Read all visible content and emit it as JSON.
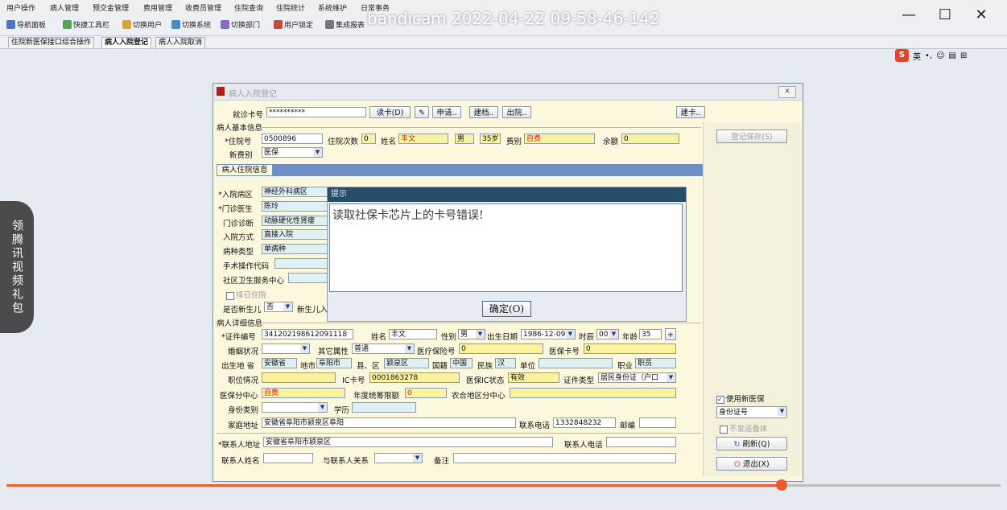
{
  "recorder": {
    "title": "bandicam 2022-04-22 09-58-46-142",
    "side_text": "领腾讯视频礼包",
    "progress_fraction": 0.78
  },
  "window_controls": {
    "minimize": "—",
    "maximize": "☐",
    "close": "✕"
  },
  "menubar": [
    "用户操作",
    "病人管理",
    "预交金管理",
    "费用管理",
    "收费员管理",
    "住院查询",
    "住院统计",
    "系统维护",
    "日常事务"
  ],
  "toolbar": [
    "导航面板",
    "快捷工具栏",
    "切换用户",
    "切换系统",
    "切换部门",
    "用户锁定",
    "集成报表"
  ],
  "app_tabs": [
    "住院新医保接口综合操作",
    "病人入院登记",
    "病人入院取消"
  ],
  "ime": {
    "logo": "S",
    "mode": "英"
  },
  "dialog": {
    "title": "病人入院登记",
    "card": {
      "label": "就诊卡号",
      "value": "**********"
    },
    "top_buttons": {
      "read_card": "读卡(D)",
      "apply": "申请..",
      "edit": "建档..",
      "discharge": "出院..",
      "make_card": "建卡.."
    },
    "basic_section": "病人基本信息",
    "basic": {
      "inpatient_no_label": "*住院号",
      "inpatient_no": "0500896",
      "times_label": "住院次数",
      "times": "0",
      "name_label": "姓名",
      "name": "丰文",
      "gender": "男",
      "age": "35岁",
      "fee_type_label": "费别",
      "fee_type": "自费",
      "balance_label": "余额",
      "balance": "0",
      "new_fee_type_label": "新费别",
      "new_fee_type": "医保"
    },
    "inner_tab": "病人住院信息",
    "admission": {
      "ward_label": "*入院病区",
      "ward": "神经外科病区",
      "doctor_label": "*门诊医生",
      "doctor": "陈玲",
      "diagnosis_label": "门诊诊断",
      "diagnosis": "动脉硬化性肾瘘",
      "way_label": "入院方式",
      "way": "直接入院",
      "disease_type_label": "病种类型",
      "disease_type": "单病种",
      "surgery_label": "手术操作代码",
      "surgery": "",
      "community_label": "社区卫生服务中心",
      "community": "",
      "same_day": "择日住院",
      "newborn_label": "是否新生儿",
      "newborn": "否",
      "newborn_in_label": "新生儿入"
    },
    "detail_section": "病人详细信息",
    "detail": {
      "id_label": "*证件编号",
      "id_no": "341202198612091118",
      "name_label": "姓名",
      "name": "丰文",
      "gender_label": "性别",
      "gender": "男",
      "birth_label": "出生日期",
      "birth": "1986-12-09",
      "hour_label": "时辰",
      "hour": "00",
      "age_label": "年龄",
      "age": "35",
      "marital_label": "婚姻状况",
      "marital": "",
      "other_label": "其它属性",
      "other": "普通",
      "insurance_label": "医疗保险号",
      "insurance": "0",
      "card_label": "医保卡号",
      "card": "0",
      "birthplace_label": "出生地 省",
      "province": "安徽省",
      "city_label": "地市",
      "city": "阜阳市",
      "county_label": "县、区",
      "county": "颍泉区",
      "nation_label": "国籍",
      "nation": "中国",
      "ethnic_label": "民族",
      "ethnic": "汉",
      "unit_label": "单位",
      "unit": "",
      "job_label": "职业",
      "job": "职员",
      "title_label": "职位情况",
      "title_value": "",
      "ic_label": "IC卡号",
      "ic": "0001863278",
      "ic_status_label": "医保IC状态",
      "ic_status": "有效",
      "doc_type_label": "证件类型",
      "doc_type": "居民身份证（户口",
      "center_label": "医保分中心",
      "center": "自费",
      "annual_label": "年度统筹限额",
      "annual": "0",
      "rural_label": "农合地区分中心",
      "rural": "",
      "identity_label": "身份类别",
      "identity": "",
      "edu_label": "学历",
      "edu": "",
      "address_label": "家庭地址",
      "address": "安徽省阜阳市颍泉区阜阳",
      "phone_label": "联系电话",
      "phone": "1332848232",
      "zip_label": "邮编",
      "zip": "",
      "contact_addr_label": "*联系人地址",
      "contact_addr": "安徽省阜阳市颍泉区",
      "contact_phone_label": "联系人电话",
      "contact_phone": "",
      "contact_name_label": "联系人姓名",
      "contact_name": "",
      "relation_label": "与联系人关系",
      "relation": "",
      "note_label": "备注",
      "note": ""
    },
    "right": {
      "save": "登记保存(S)",
      "use_new_insurance": "使用新医保",
      "id_select": "身份证号",
      "no_bed": "不发送备床",
      "refresh": "刷新(Q)",
      "exit": "退出(X)"
    }
  },
  "alert": {
    "title": "提示",
    "message": "读取社保卡芯片上的卡号错误!",
    "ok": "确定(O)"
  }
}
